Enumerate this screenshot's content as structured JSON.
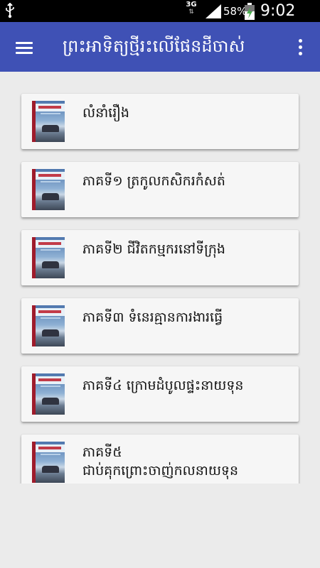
{
  "status_bar": {
    "network": "3G",
    "battery": "58%",
    "time": "9:02 PM"
  },
  "app_bar": {
    "title": "ព្រះអាទិត្យថ្មីរះលើផែនដីចាស់"
  },
  "chapters": [
    {
      "label": "លំនាំរឿង"
    },
    {
      "label": "ភាគទី១ ត្រកូលកសិករកំសត់"
    },
    {
      "label": "ភាគទី២ ជីវិតកម្មករនៅទីក្រុង"
    },
    {
      "label": "ភាគទី៣ ទំនេរគ្មានការងារធ្វើ"
    },
    {
      "label": "ភាគទី៤ ក្រោមដំបូលផ្ទះនាយទុន"
    },
    {
      "label": "ភាគទី៥\nជាប់គុកព្រោះចាញ់កលនាយទុន"
    }
  ],
  "colors": {
    "app_bar": "#3f51b5",
    "background": "#ebebeb",
    "card": "#f6f6f6"
  }
}
